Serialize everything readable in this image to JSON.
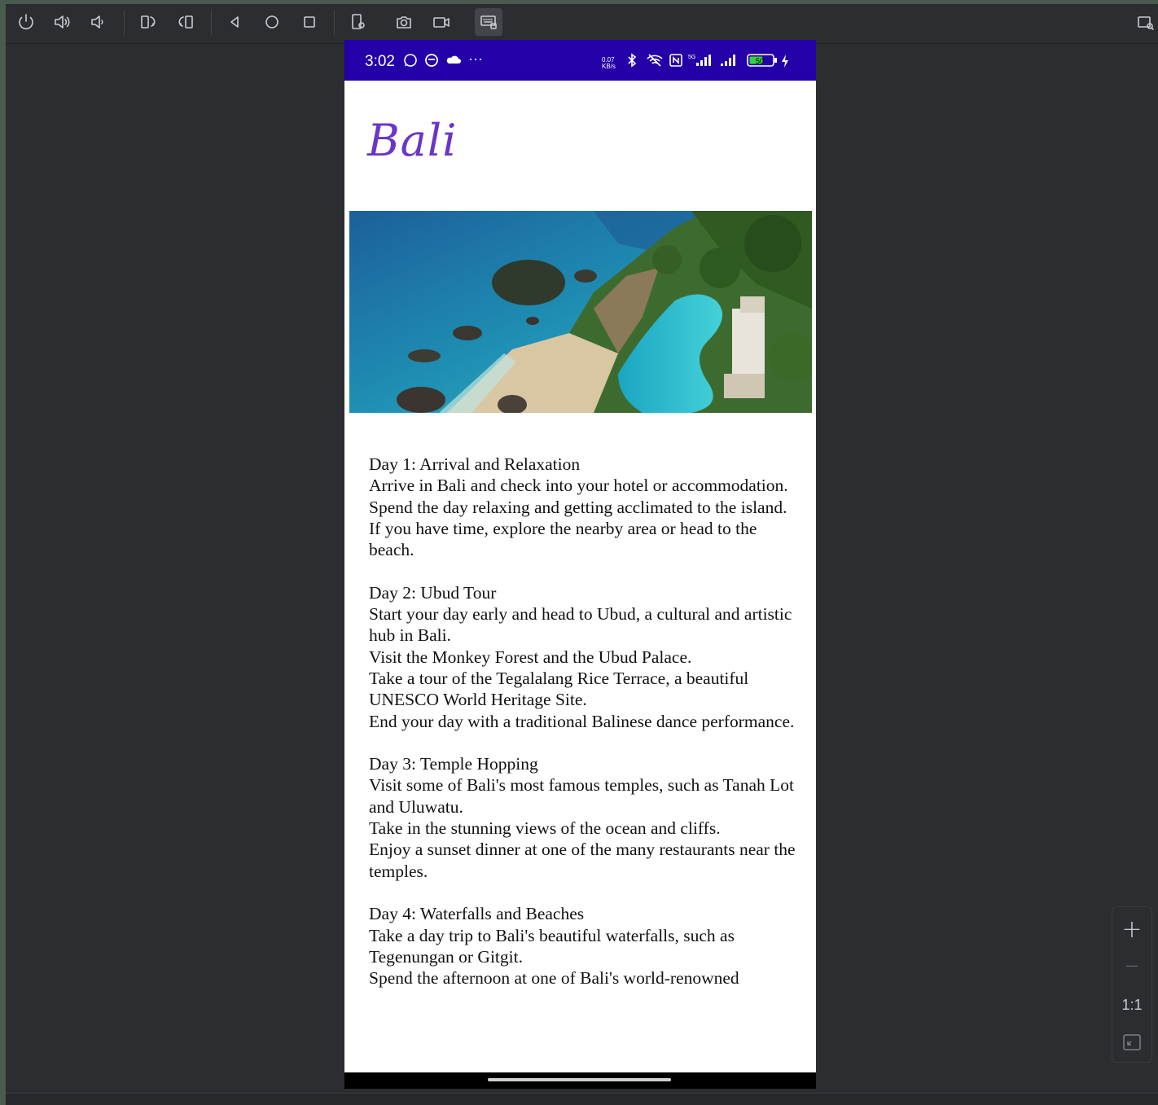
{
  "toolbar": {
    "buttons": [
      "power-icon",
      "volume-up-icon",
      "volume-down-icon",
      "rotate-left-icon",
      "rotate-right-icon",
      "back-icon",
      "home-icon",
      "overview-icon",
      "device-settings-icon",
      "camera-icon",
      "screen-record-icon",
      "keyboard-icon"
    ],
    "active_button": "keyboard-icon"
  },
  "statusbar": {
    "time": "3:02",
    "left_icons": [
      "whatsapp-icon",
      "circle-app-icon",
      "cloud-icon",
      "more-icon"
    ],
    "right_icons": [
      "data-rate-icon",
      "bluetooth-icon",
      "wifi-off-icon",
      "nfc-icon",
      "signal-5g-icon",
      "signal-icon",
      "battery-icon",
      "charging-icon"
    ],
    "data_rate": "0.07\nKB/s",
    "battery": "50",
    "bg_color": "#2400a8"
  },
  "app": {
    "title": "Bali",
    "title_color": "#6a35c9",
    "hero_image": "Bali coastline with beach, rocks and cliffside infinity pool",
    "itinerary": "Day 1: Arrival and Relaxation\nArrive in Bali and check into your hotel or accommodation.\nSpend the day relaxing and getting acclimated to the island.\nIf you have time, explore the nearby area or head to the beach.\n\nDay 2: Ubud Tour\nStart your day early and head to Ubud, a cultural and artistic hub in Bali.\nVisit the Monkey Forest and the Ubud Palace.\nTake a tour of the Tegalalang Rice Terrace, a beautiful UNESCO World Heritage Site.\nEnd your day with a traditional Balinese dance performance.\n\nDay 3: Temple Hopping\nVisit some of Bali's most famous temples, such as Tanah Lot and Uluwatu.\nTake in the stunning views of the ocean and cliffs.\nEnjoy a sunset dinner at one of the many restaurants near the temples.\n\nDay 4: Waterfalls and Beaches\nTake a day trip to Bali's beautiful waterfalls, such as Tegenungan or Gitgit.\nSpend the afternoon at one of Bali's world-renowned"
  },
  "zoom": {
    "plus": "+",
    "minus": "—",
    "ratio": "1:1"
  }
}
